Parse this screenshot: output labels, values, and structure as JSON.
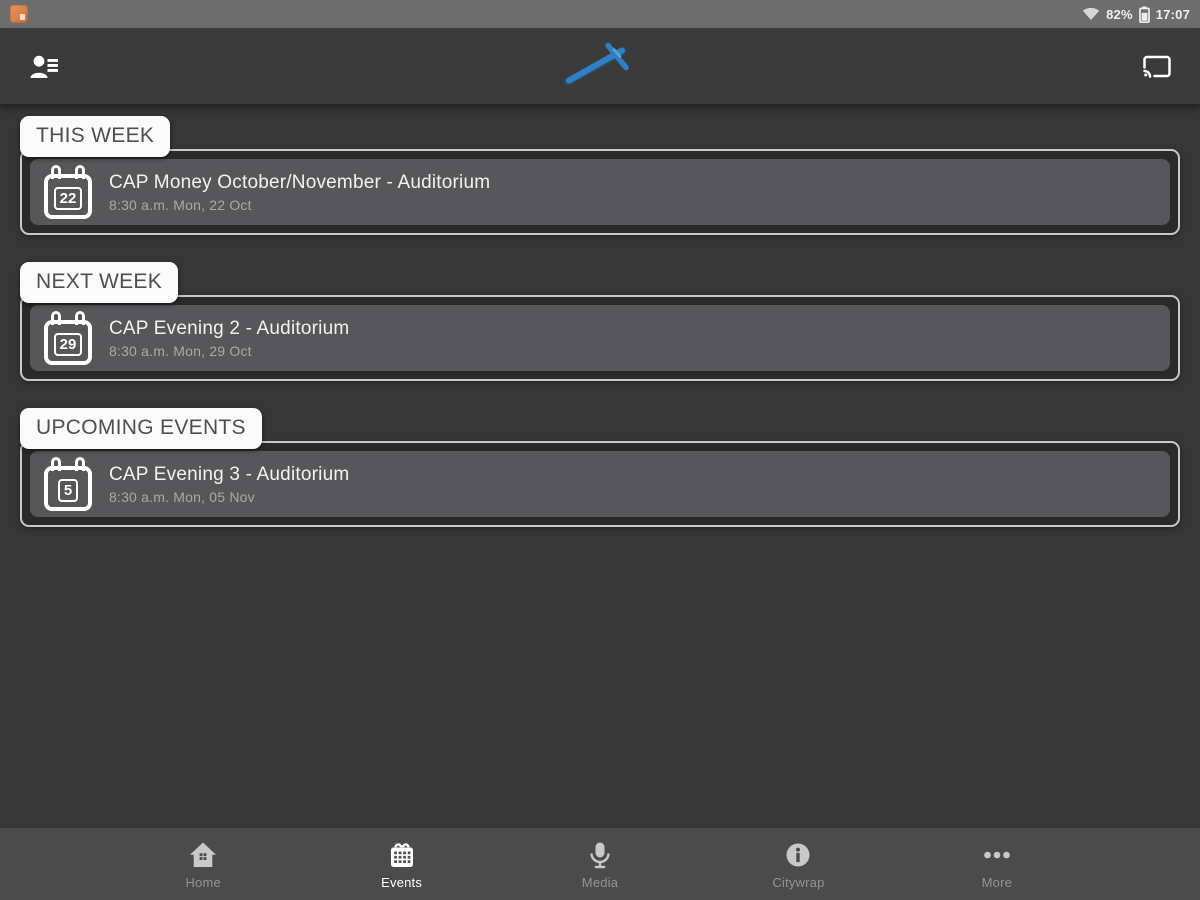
{
  "status_bar": {
    "battery_percent": "82%",
    "time": "17:07"
  },
  "sections": [
    {
      "label": "THIS WEEK",
      "events": [
        {
          "day": "22",
          "title": "CAP Money October/November - Auditorium",
          "datetime": "8:30 a.m. Mon, 22 Oct"
        }
      ]
    },
    {
      "label": "NEXT WEEK",
      "events": [
        {
          "day": "29",
          "title": "CAP Evening 2 - Auditorium",
          "datetime": "8:30 a.m. Mon, 29 Oct"
        }
      ]
    },
    {
      "label": "UPCOMING EVENTS",
      "events": [
        {
          "day": "5",
          "title": "CAP Evening 3 - Auditorium",
          "datetime": "8:30 a.m. Mon, 05 Nov"
        }
      ]
    }
  ],
  "nav": {
    "items": [
      {
        "label": "Home",
        "icon": "home-icon",
        "active": false
      },
      {
        "label": "Events",
        "icon": "calendar-icon",
        "active": true
      },
      {
        "label": "Media",
        "icon": "microphone-icon",
        "active": false
      },
      {
        "label": "Citywrap",
        "icon": "info-icon",
        "active": false
      },
      {
        "label": "More",
        "icon": "more-dots-icon",
        "active": false
      }
    ]
  },
  "colors": {
    "accent_blue": "#2f80c2",
    "status_orange": "#dd8147",
    "card_bg": "#57575a",
    "section_border": "#c9c9c9",
    "nav_bg": "#4b4b4b"
  }
}
